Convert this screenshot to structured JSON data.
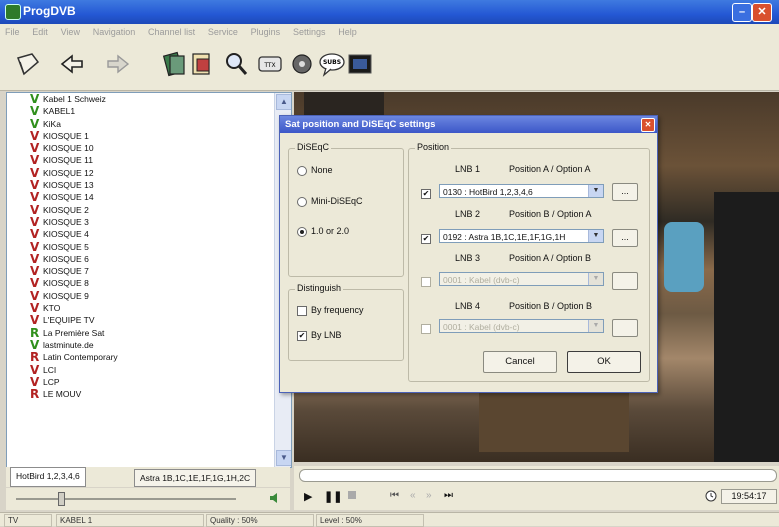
{
  "app": {
    "title": "ProgDVB"
  },
  "menu": [
    "File",
    "Edit",
    "View",
    "Navigation",
    "Channel list",
    "Service",
    "Plugins",
    "Settings",
    "Help"
  ],
  "toolbar_icons": [
    "open-icon",
    "back-icon",
    "forward-icon",
    "record-icon",
    "scheduler-icon",
    "search-icon",
    "teletext-icon",
    "epg-icon",
    "subs-icon",
    "video-icon"
  ],
  "toolbar_subs_label": "SUBS",
  "channels": [
    {
      "mark": "V",
      "color": "v",
      "name": "Kabel 1 Schweiz"
    },
    {
      "mark": "V",
      "color": "v",
      "name": "KABEL1"
    },
    {
      "mark": "V",
      "color": "v",
      "name": "KiKa"
    },
    {
      "mark": "V",
      "color": "b",
      "name": "KIOSQUE 1"
    },
    {
      "mark": "V",
      "color": "b",
      "name": "KIOSQUE 10"
    },
    {
      "mark": "V",
      "color": "b",
      "name": "KIOSQUE 11"
    },
    {
      "mark": "V",
      "color": "b",
      "name": "KIOSQUE 12"
    },
    {
      "mark": "V",
      "color": "b",
      "name": "KIOSQUE 13"
    },
    {
      "mark": "V",
      "color": "b",
      "name": "KIOSQUE 14"
    },
    {
      "mark": "V",
      "color": "b",
      "name": "KIOSQUE 2"
    },
    {
      "mark": "V",
      "color": "b",
      "name": "KIOSQUE 3"
    },
    {
      "mark": "V",
      "color": "b",
      "name": "KIOSQUE 4"
    },
    {
      "mark": "V",
      "color": "b",
      "name": "KIOSQUE 5"
    },
    {
      "mark": "V",
      "color": "b",
      "name": "KIOSQUE 6"
    },
    {
      "mark": "V",
      "color": "b",
      "name": "KIOSQUE 7"
    },
    {
      "mark": "V",
      "color": "b",
      "name": "KIOSQUE 8"
    },
    {
      "mark": "V",
      "color": "b",
      "name": "KIOSQUE 9"
    },
    {
      "mark": "V",
      "color": "b",
      "name": "KTO"
    },
    {
      "mark": "V",
      "color": "b",
      "name": "L'EQUIPE TV"
    },
    {
      "mark": "R",
      "color": "r",
      "name": "La Première Sat"
    },
    {
      "mark": "V",
      "color": "v",
      "name": "lastminute.de"
    },
    {
      "mark": "R",
      "color": "b",
      "name": "Latin Contemporary"
    },
    {
      "mark": "V",
      "color": "b",
      "name": "LCI"
    },
    {
      "mark": "V",
      "color": "b",
      "name": "LCP"
    },
    {
      "mark": "R",
      "color": "b",
      "name": "LE MOUV"
    }
  ],
  "tabs": [
    "HotBird 1,2,3,4,6",
    "Astra 1B,1C,1E,1F,1G,1H,2C"
  ],
  "dialog": {
    "title": "Sat position and DiSEqC settings",
    "diseqc": {
      "label": "DiSEqC",
      "options": [
        "None",
        "Mini-DiSEqC",
        "1.0 or 2.0"
      ],
      "selected": "1.0 or 2.0"
    },
    "distinguish": {
      "label": "Distinguish",
      "by_frequency": {
        "label": "By frequency",
        "checked": false
      },
      "by_lnb": {
        "label": "By LNB",
        "checked": true
      }
    },
    "position": {
      "label": "Position",
      "lnbs": [
        {
          "name": "LNB 1",
          "option": "Position A / Option A",
          "value": "0130 : HotBird 1,2,3,4,6",
          "checked": true,
          "enabled": true
        },
        {
          "name": "LNB 2",
          "option": "Position B / Option A",
          "value": "0192 : Astra 1B,1C,1E,1F,1G,1H",
          "checked": true,
          "enabled": true
        },
        {
          "name": "LNB 3",
          "option": "Position A / Option B",
          "value": "0001 : Kabel (dvb-c)",
          "checked": false,
          "enabled": false
        },
        {
          "name": "LNB 4",
          "option": "Position B / Option B",
          "value": "0001 : Kabel (dvb-c)",
          "checked": false,
          "enabled": false
        }
      ],
      "more_label": "..."
    },
    "cancel_label": "Cancel",
    "ok_label": "OK"
  },
  "player": {
    "time": "19:54:17"
  },
  "status": {
    "tv": "TV",
    "channel": "KABEL 1",
    "quality": "Quality : 50%",
    "level": "Level : 50%"
  }
}
